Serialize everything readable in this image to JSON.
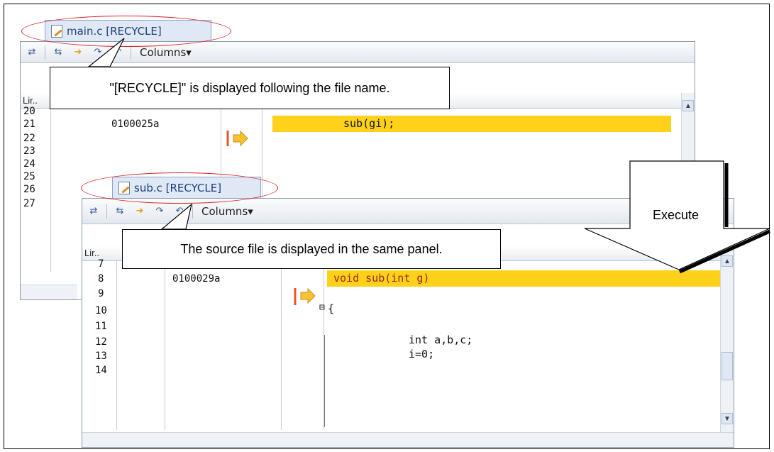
{
  "main_panel": {
    "tab_title": "main.c [RECYCLE]",
    "toolbar": {
      "columns_label": "Columns▾"
    },
    "col_header": {
      "line_label": "Lir.."
    },
    "lines": [
      "20",
      "21",
      "22",
      "23",
      "24",
      "25",
      "26",
      "27"
    ],
    "highlight_address": "0100025a",
    "highlight_source": "sub(gi);"
  },
  "sub_panel": {
    "tab_title": "sub.c [RECYCLE]",
    "toolbar": {
      "columns_label": "Columns▾"
    },
    "col_header": {
      "line_label": "Lir.."
    },
    "lines": [
      "7",
      "8",
      "9",
      "10",
      "11",
      "12",
      "13",
      "14"
    ],
    "highlight_address": "0100029a",
    "source": {
      "line8": "void sub(int g)",
      "line10": "{",
      "line12": "int a,b,c;",
      "line13": "i=0;"
    }
  },
  "callouts": {
    "main_note": "\"[RECYCLE]\" is displayed following the file name.",
    "sub_note": "The source file is displayed in the same panel.",
    "execute_label": "Execute"
  },
  "colors": {
    "highlight": "#ffd11a",
    "annotation_ellipse": "#e0242b",
    "tab_text": "#1c3f80"
  }
}
